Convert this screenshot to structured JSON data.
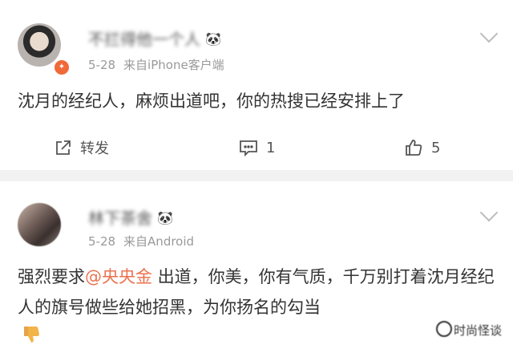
{
  "comments": [
    {
      "username": "不拦得他一个人",
      "emoji": "🐼",
      "date": "5-28",
      "source": "来自iPhone客户端",
      "text": "沈月的经纪人，麻烦出道吧，你的热搜已经安排上了",
      "actions": {
        "forward_label": "转发",
        "comment_count": "1",
        "like_count": "5"
      }
    },
    {
      "username": "林下茶舍",
      "emoji": "🐼",
      "date": "5-28",
      "source": "来自Android",
      "text_prefix": "强烈要求",
      "mention": "@央央金",
      "text_suffix": " 出道，你美，你有气质，千万别打着沈月经纪人的旗号做些给她招黑，为你扬名的勾当"
    }
  ],
  "watermark": "时尚怪谈",
  "colors": {
    "mention": "#eb7350",
    "badge": "#f06a39",
    "meta": "#9a9a9a"
  },
  "icons": [
    "forward-icon",
    "comment-icon",
    "like-icon",
    "dislike-icon",
    "chevron-down-icon"
  ]
}
